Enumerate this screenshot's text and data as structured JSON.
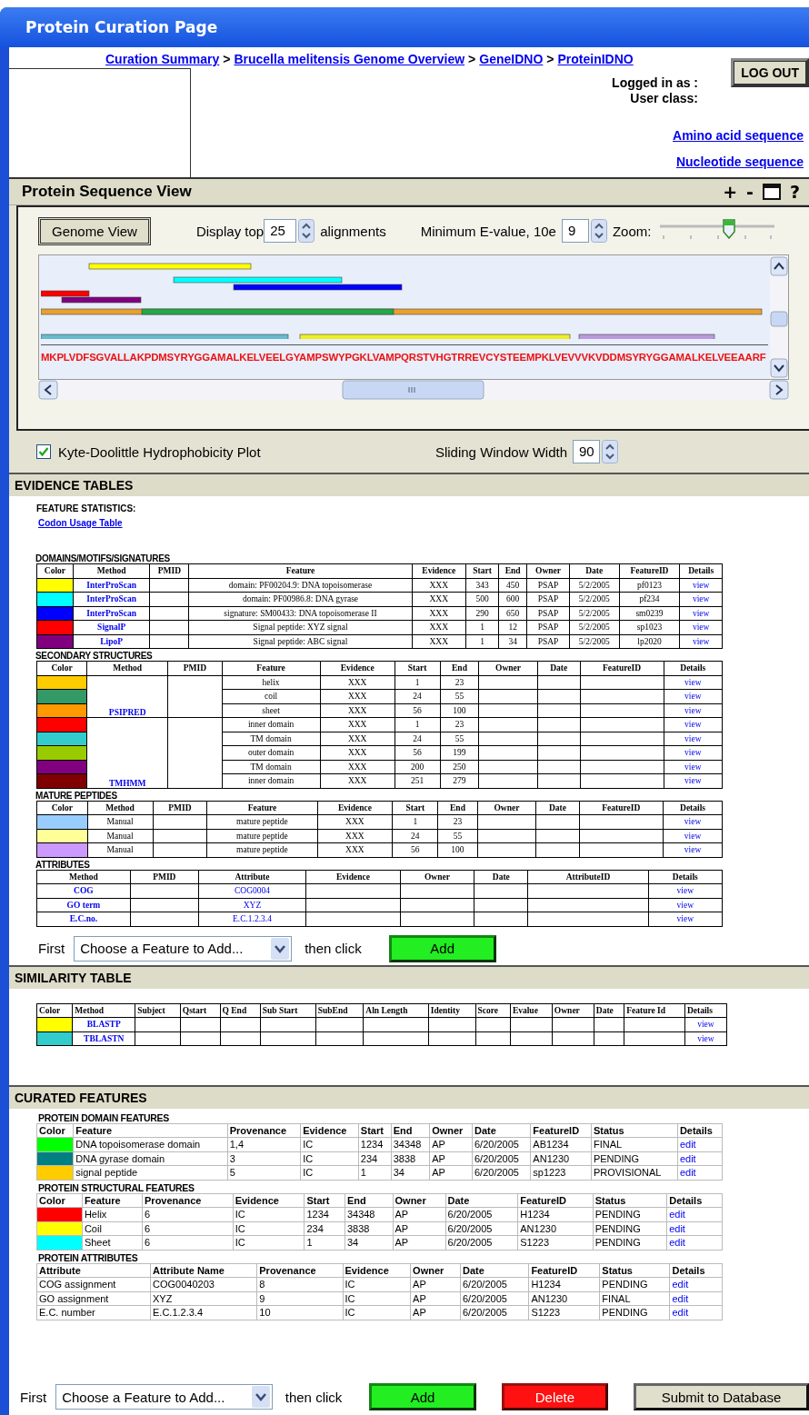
{
  "window": {
    "title": "Protein Curation Page"
  },
  "breadcrumb": [
    {
      "kind": "link",
      "text": "Curation Summary"
    },
    {
      "kind": "sep",
      "text": ">"
    },
    {
      "kind": "link",
      "text": "Brucella melitensis Genome Overview"
    },
    {
      "kind": "sep",
      "text": ">"
    },
    {
      "kind": "link",
      "text": "GeneIDNO"
    },
    {
      "kind": "sep",
      "text": ">"
    },
    {
      "kind": "link",
      "text": "ProteinIDNO"
    }
  ],
  "logout_button": "LOG OUT",
  "user_info": [
    "Logged in as :",
    "User class:"
  ],
  "sequence_links": [
    "Amino acid sequence",
    "Nucleotide sequence"
  ],
  "sequence_view": {
    "title": "Protein Sequence View",
    "tools": [
      {
        "kind": "text",
        "label": "+"
      },
      {
        "kind": "text",
        "label": "-"
      },
      {
        "kind": "maximize"
      },
      {
        "kind": "text",
        "label": "?"
      }
    ],
    "genome_view_button": "Genome View",
    "display_top": {
      "label": "Display top",
      "value": "25",
      "suffix": "alignments"
    },
    "evalue": {
      "label": "Minimum  E-value, 10e",
      "value": "9"
    },
    "zoom": {
      "label": "Zoom:",
      "level": 0.6
    },
    "sequence": "MKPLVDFSGVALLAKPDMSYRYGGAMALKELVEELGYAMPSWYPGKLVAMPQRSTVHGTRREVCYSTEEMPKLVEVVVKVDDMSYRYGGAMALKELVEEAARF",
    "hydrophobicity": {
      "label": "Kyte-Doolittle Hydrophobicity  Plot",
      "checked": true
    },
    "window_width": {
      "label": "Sliding Window Width",
      "value": "90"
    }
  },
  "evidence": {
    "title": "EVIDENCE TABLES",
    "statistics_label": "FEATURE STATISTICS:",
    "statistics_link": "Codon Usage Table",
    "tables": [
      {
        "title": "DOMAINS/MOTIFS/SIGNATURES",
        "columns": [
          "Color",
          "Method",
          "PMID",
          "Feature",
          "Evidence",
          "Start",
          "End",
          "Owner",
          "Date",
          "FeatureID",
          "Details"
        ],
        "rows": [
          {
            "cells": [
              {
                "kind": "swatch",
                "color": "#ffff00"
              },
              {
                "kind": "method",
                "text": "InterProScan"
              },
              null,
              "domain: PF00204.9: DNA topoisomerase",
              "XXX",
              "343",
              "450",
              "PSAP",
              "5/2/2005",
              "pf0123",
              {
                "kind": "link",
                "text": "view"
              }
            ]
          },
          {
            "cells": [
              {
                "kind": "swatch",
                "color": "#00ffff"
              },
              {
                "kind": "method",
                "text": "InterProScan"
              },
              null,
              "domain: PF00986.8: DNA gyrase",
              "XXX",
              "500",
              "600",
              "PSAP",
              "5/2/2005",
              "pf234",
              {
                "kind": "link",
                "text": "view"
              }
            ]
          },
          {
            "cells": [
              {
                "kind": "swatch",
                "color": "#0000ff"
              },
              {
                "kind": "method",
                "text": "InterProScan"
              },
              null,
              "signature: SM00433: DNA topoisomerase II",
              "XXX",
              "290",
              "650",
              "PSAP",
              "5/2/2005",
              "sm0239",
              {
                "kind": "link",
                "text": "view"
              }
            ]
          },
          {
            "cells": [
              {
                "kind": "swatch",
                "color": "#ff0000"
              },
              {
                "kind": "method",
                "text": "SignalP"
              },
              null,
              "Signal peptide: XYZ signal",
              "XXX",
              "1",
              "12",
              "PSAP",
              "5/2/2005",
              "sp1023",
              {
                "kind": "link",
                "text": "view"
              }
            ]
          },
          {
            "cells": [
              {
                "kind": "swatch",
                "color": "#800080"
              },
              {
                "kind": "method",
                "text": "LipoP"
              },
              null,
              "Signal peptide: ABC signal",
              "XXX",
              "1",
              "34",
              "PSAP",
              "5/2/2005",
              "lp2020",
              {
                "kind": "link",
                "text": "view"
              }
            ]
          }
        ]
      },
      {
        "title": "SECONDARY STRUCTURES",
        "columns": [
          "Color",
          "Method",
          "PMID",
          "Feature",
          "Evidence",
          "Start",
          "End",
          "Owner",
          "Date",
          "FeatureID",
          "Details"
        ],
        "groups": [
          {
            "method": "PSIPRED",
            "rows": [
              {
                "cells": [
                  {
                    "kind": "swatch",
                    "color": "#ffcc00"
                  },
                  "helix",
                  "XXX",
                  "1",
                  "23",
                  null,
                  null,
                  null,
                  {
                    "kind": "link",
                    "text": "view"
                  }
                ]
              },
              {
                "cells": [
                  {
                    "kind": "swatch",
                    "color": "#339966"
                  },
                  "coil",
                  "XXX",
                  "24",
                  "55",
                  null,
                  null,
                  null,
                  {
                    "kind": "link",
                    "text": "view"
                  }
                ]
              },
              {
                "cells": [
                  {
                    "kind": "swatch",
                    "color": "#ff9900"
                  },
                  "sheet",
                  "XXX",
                  "56",
                  "100",
                  null,
                  null,
                  null,
                  {
                    "kind": "link",
                    "text": "view"
                  }
                ]
              }
            ]
          },
          {
            "method": "TMHMM",
            "rows": [
              {
                "cells": [
                  {
                    "kind": "swatch",
                    "color": "#ff0000"
                  },
                  "inner domain",
                  "XXX",
                  "1",
                  "23",
                  null,
                  null,
                  null,
                  {
                    "kind": "link",
                    "text": "view"
                  }
                ]
              },
              {
                "cells": [
                  {
                    "kind": "swatch",
                    "color": "#33cccc"
                  },
                  "TM domain",
                  "XXX",
                  "24",
                  "55",
                  null,
                  null,
                  null,
                  {
                    "kind": "link",
                    "text": "view"
                  }
                ]
              },
              {
                "cells": [
                  {
                    "kind": "swatch",
                    "color": "#99cc00"
                  },
                  "outer domain",
                  "XXX",
                  "56",
                  "199",
                  null,
                  null,
                  null,
                  {
                    "kind": "link",
                    "text": "view"
                  }
                ]
              },
              {
                "cells": [
                  {
                    "kind": "swatch",
                    "color": "#800080"
                  },
                  "TM domain",
                  "XXX",
                  "200",
                  "250",
                  null,
                  null,
                  null,
                  {
                    "kind": "link",
                    "text": "view"
                  }
                ]
              },
              {
                "cells": [
                  {
                    "kind": "swatch",
                    "color": "#800000"
                  },
                  "inner domain",
                  "XXX",
                  "251",
                  "279",
                  null,
                  null,
                  null,
                  {
                    "kind": "link",
                    "text": "view"
                  }
                ]
              }
            ]
          }
        ]
      },
      {
        "title": "MATURE PEPTIDES",
        "columns": [
          "Color",
          "Method",
          "PMID",
          "Feature",
          "Evidence",
          "Start",
          "End",
          "Owner",
          "Date",
          "FeatureID",
          "Details"
        ],
        "rows": [
          {
            "cells": [
              {
                "kind": "swatch",
                "color": "#99ccff"
              },
              "Manual",
              null,
              "mature peptide",
              "XXX",
              "1",
              "23",
              null,
              null,
              null,
              {
                "kind": "link",
                "text": "view"
              }
            ]
          },
          {
            "cells": [
              {
                "kind": "swatch",
                "color": "#ffff99"
              },
              "Manual",
              null,
              "mature peptide",
              "XXX",
              "24",
              "55",
              null,
              null,
              null,
              {
                "kind": "link",
                "text": "view"
              }
            ]
          },
          {
            "cells": [
              {
                "kind": "swatch",
                "color": "#cc99ff"
              },
              "Manual",
              null,
              "mature peptide",
              "XXX",
              "56",
              "100",
              null,
              null,
              null,
              {
                "kind": "link",
                "text": "view"
              }
            ]
          }
        ]
      },
      {
        "title": "ATTRIBUTES",
        "columns": [
          "Method",
          "PMID",
          "Attribute",
          "Evidence",
          "Owner",
          "Date",
          "AttributeID",
          "Details"
        ],
        "rows": [
          {
            "cells": [
              {
                "kind": "method",
                "text": "COG"
              },
              null,
              {
                "kind": "link",
                "text": "COG0004"
              },
              null,
              null,
              null,
              null,
              {
                "kind": "link",
                "text": "view"
              }
            ]
          },
          {
            "cells": [
              {
                "kind": "method",
                "text": "GO term"
              },
              null,
              {
                "kind": "link",
                "text": "XYZ"
              },
              null,
              null,
              null,
              null,
              {
                "kind": "link",
                "text": "view"
              }
            ]
          },
          {
            "cells": [
              {
                "kind": "method",
                "text": "E.C.no."
              },
              null,
              {
                "kind": "link",
                "text": "E.C.1.2.3.4"
              },
              null,
              null,
              null,
              null,
              {
                "kind": "link",
                "text": "view"
              }
            ]
          }
        ]
      }
    ],
    "add_row": {
      "prefix": "First",
      "value": "Choose a Feature to Add...",
      "middle": "then click",
      "buttons": [
        {
          "kind": "add",
          "label": "Add"
        }
      ]
    }
  },
  "similarity": {
    "title": "SIMILARITY TABLE",
    "table": {
      "columns": [
        "Color",
        "Method",
        "Subject",
        "Qstart",
        "Q End",
        "Sub Start",
        "SubEnd",
        "Aln Length",
        "Identity",
        "Score",
        "Evalue",
        "Owner",
        "Date",
        "Feature Id",
        "Details"
      ],
      "rows": [
        {
          "cells": [
            {
              "kind": "swatch",
              "color": "#ffff00"
            },
            {
              "kind": "method",
              "text": "BLASTP"
            },
            null,
            null,
            null,
            null,
            null,
            null,
            null,
            null,
            null,
            null,
            null,
            null,
            {
              "kind": "link",
              "text": "view"
            }
          ]
        },
        {
          "cells": [
            {
              "kind": "swatch",
              "color": "#33cccc"
            },
            {
              "kind": "method",
              "text": "TBLASTN"
            },
            null,
            null,
            null,
            null,
            null,
            null,
            null,
            null,
            null,
            null,
            null,
            null,
            {
              "kind": "link",
              "text": "view"
            }
          ]
        }
      ]
    }
  },
  "curated": {
    "title": "CURATED FEATURES",
    "tables": [
      {
        "title": "PROTEIN DOMAIN FEATURES",
        "columns": [
          "Color",
          "Feature",
          "Provenance",
          "Evidence",
          "Start",
          "End",
          "Owner",
          "Date",
          "FeatureID",
          "Status",
          "Details"
        ],
        "rows": [
          {
            "cells": [
              {
                "kind": "swatch",
                "color": "#00ff00"
              },
              "DNA topoisomerase domain",
              "1,4",
              "IC",
              "1234",
              "34348",
              "AP",
              "6/20/2005",
              "AB1234",
              "FINAL",
              {
                "kind": "link",
                "text": "edit"
              }
            ]
          },
          {
            "cells": [
              {
                "kind": "swatch",
                "color": "#008080"
              },
              "DNA gyrase domain",
              "3",
              "IC",
              "234",
              "3838",
              "AP",
              "6/20/2005",
              "AN1230",
              "PENDING",
              {
                "kind": "link",
                "text": "edit"
              }
            ]
          },
          {
            "cells": [
              {
                "kind": "swatch",
                "color": "#ffcc00"
              },
              "signal peptide",
              "5",
              "IC",
              "1",
              "34",
              "AP",
              "6/20/2005",
              "sp1223",
              "PROVISIONAL",
              {
                "kind": "link",
                "text": "edit"
              }
            ]
          }
        ]
      },
      {
        "title": "PROTEIN STRUCTURAL FEATURES",
        "columns": [
          "Color",
          "Feature",
          "Provenance",
          "Evidence",
          "Start",
          "End",
          "Owner",
          "Date",
          "FeatureID",
          "Status",
          "Details"
        ],
        "rows": [
          {
            "cells": [
              {
                "kind": "swatch",
                "color": "#ff0000"
              },
              "Helix",
              "6",
              "IC",
              "1234",
              "34348",
              "AP",
              "6/20/2005",
              "H1234",
              "PENDING",
              {
                "kind": "link",
                "text": "edit"
              }
            ]
          },
          {
            "cells": [
              {
                "kind": "swatch",
                "color": "#ffff00"
              },
              "Coil",
              "6",
              "IC",
              "234",
              "3838",
              "AP",
              "6/20/2005",
              "AN1230",
              "PENDING",
              {
                "kind": "link",
                "text": "edit"
              }
            ]
          },
          {
            "cells": [
              {
                "kind": "swatch",
                "color": "#00ffff"
              },
              "Sheet",
              "6",
              "IC",
              "1",
              "34",
              "AP",
              "6/20/2005",
              "S1223",
              "PENDING",
              {
                "kind": "link",
                "text": "edit"
              }
            ]
          }
        ]
      },
      {
        "title": "PROTEIN ATTRIBUTES",
        "columns": [
          "Attribute",
          "Attribute Name",
          "Provenance",
          "Evidence",
          "Owner",
          "Date",
          "FeatureID",
          "Status",
          "Details"
        ],
        "rows": [
          {
            "cells": [
              "COG assignment",
              "COG0040203",
              "8",
              "IC",
              "AP",
              "6/20/2005",
              "H1234",
              "PENDING",
              {
                "kind": "link",
                "text": "edit"
              }
            ]
          },
          {
            "cells": [
              "GO assignment",
              "XYZ",
              "9",
              "IC",
              "AP",
              "6/20/2005",
              "AN1230",
              "FINAL",
              {
                "kind": "link",
                "text": "edit"
              }
            ]
          },
          {
            "cells": [
              "E.C. number",
              "E.C.1.2.3.4",
              "10",
              "IC",
              "AP",
              "6/20/2005",
              "S1223",
              "PENDING",
              {
                "kind": "link",
                "text": "edit"
              }
            ]
          }
        ]
      }
    ],
    "add_row": {
      "prefix": "First",
      "value": "Choose a Feature to Add...",
      "middle": "then click",
      "buttons": [
        {
          "kind": "add",
          "label": "Add"
        },
        {
          "kind": "delete",
          "label": "Delete"
        },
        {
          "kind": "submit",
          "label": "Submit to Database"
        }
      ]
    }
  }
}
